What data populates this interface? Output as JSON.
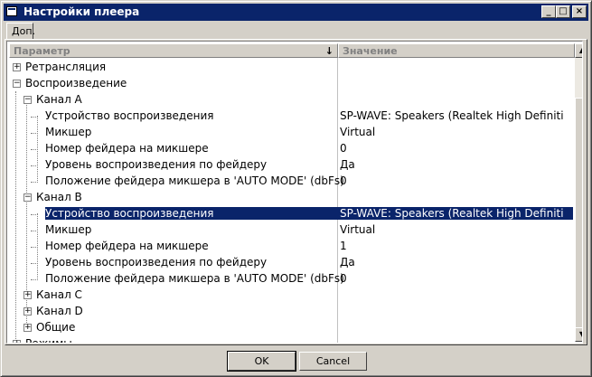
{
  "window": {
    "title": "Настройки плеера",
    "buttons": {
      "minimize": "_",
      "maximize": "□",
      "close": "×"
    }
  },
  "tabs": [
    {
      "label": "Доп."
    }
  ],
  "grid": {
    "header": {
      "param": "Параметр",
      "value": "Значение"
    },
    "rows": [
      {
        "name": "Ретрансляция",
        "value": ""
      },
      {
        "name": "Воспроизведение",
        "value": ""
      },
      {
        "name": "Канал A",
        "value": ""
      },
      {
        "name": "Устройство воспроизведения",
        "value": "SP-WAVE: Speakers (Realtek High Definiti"
      },
      {
        "name": "Микшер",
        "value": "Virtual"
      },
      {
        "name": "Номер фейдера на микшере",
        "value": "0"
      },
      {
        "name": "Уровень воспроизведения по фейдеру",
        "value": "Да"
      },
      {
        "name": "Положение фейдера микшера в 'AUTO MODE' (dbFs)",
        "value": "0"
      },
      {
        "name": "Канал B",
        "value": ""
      },
      {
        "name": "Устройство воспроизведения",
        "value": "SP-WAVE: Speakers (Realtek High Definiti"
      },
      {
        "name": "Микшер",
        "value": "Virtual"
      },
      {
        "name": "Номер фейдера на микшере",
        "value": "1"
      },
      {
        "name": "Уровень воспроизведения по фейдеру",
        "value": "Да"
      },
      {
        "name": "Положение фейдера микшера в 'AUTO MODE' (dbFs)",
        "value": "0"
      },
      {
        "name": "Канал C",
        "value": ""
      },
      {
        "name": "Канал D",
        "value": ""
      },
      {
        "name": "Общие",
        "value": ""
      },
      {
        "name": "Режимы",
        "value": ""
      }
    ],
    "expanders": {
      "plus": "+",
      "minus": "−"
    }
  },
  "footer": {
    "ok_label": "OK",
    "cancel_label": "Cancel"
  },
  "colors": {
    "selection": "#0a246a",
    "titlebar": "#0a246a",
    "face": "#d4d0c8"
  }
}
